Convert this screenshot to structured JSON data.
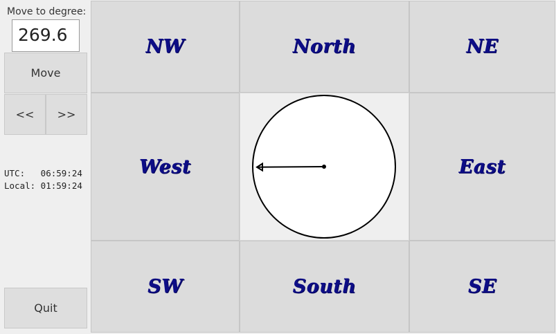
{
  "left_panel": {
    "degree_label": "Move to degree:",
    "degree_value": "269.6",
    "move_label": "Move",
    "prev_label": "<<",
    "next_label": ">>",
    "utc_line": "UTC:   06:59:24",
    "local_line": "Local: 01:59:24",
    "quit_label": "Quit"
  },
  "directions": {
    "nw": "NW",
    "north": "North",
    "ne": "NE",
    "west": "West",
    "east": "East",
    "sw": "SW",
    "south": "South",
    "se": "SE"
  },
  "compass": {
    "heading_degrees": 269.6
  },
  "colors": {
    "direction_text": "#0d0d86"
  }
}
